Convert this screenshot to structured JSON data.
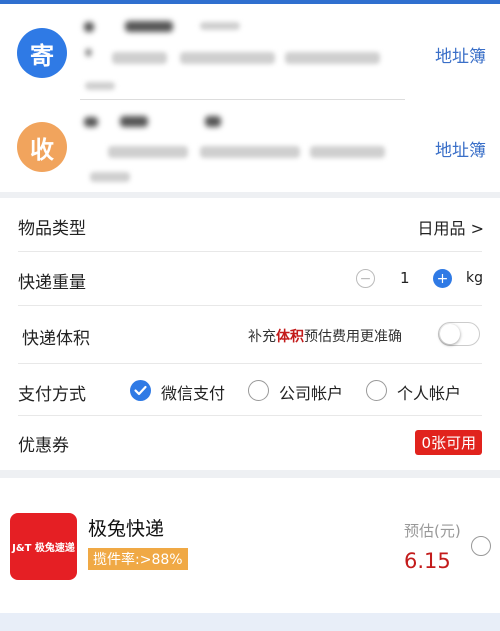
{
  "sender": {
    "avatar_char": "寄",
    "address_book": "地址簿"
  },
  "receiver": {
    "avatar_char": "收",
    "address_book": "地址簿"
  },
  "form": {
    "item_type": {
      "label": "物品类型",
      "value": "日用品 >"
    },
    "weight": {
      "label": "快递重量",
      "minus": "−",
      "value": "1",
      "plus": "+",
      "unit": "kg"
    },
    "volume": {
      "label": "快递体积",
      "hint_prefix": "补充",
      "hint_highlight": "体积",
      "hint_suffix": "预估费用更准确"
    },
    "payment": {
      "label": "支付方式",
      "options": [
        "微信支付",
        "公司帐户",
        "个人帐户"
      ],
      "selected": "微信支付"
    },
    "coupon": {
      "label": "优惠券",
      "badge": "0张可用"
    }
  },
  "courier": {
    "logo_text": "J&T 极兔速递",
    "name": "极兔快递",
    "pickup_rate": "揽件率:>88%",
    "estimate_label": "预估(元)",
    "price": "6.15"
  },
  "colors": {
    "sender": "#2f7ae5",
    "receiver": "#f1a45d",
    "link": "#3a6fc8",
    "price": "#c31b1b",
    "badge": "#e1231d",
    "rate_bg": "#f0a945"
  }
}
